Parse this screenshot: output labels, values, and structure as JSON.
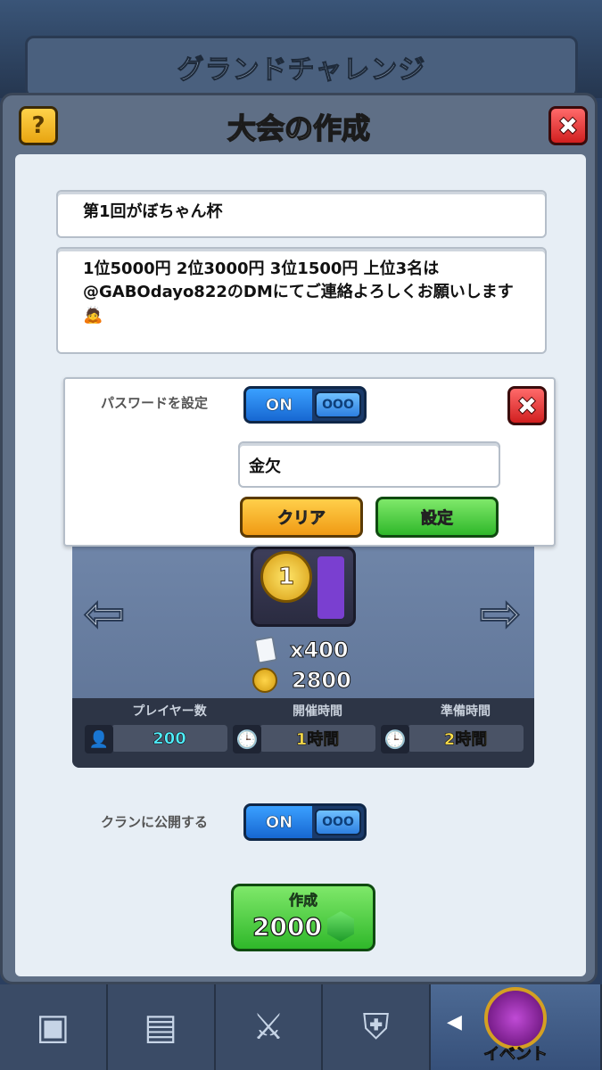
{
  "background_header": "グランドチャレンジ",
  "dialog": {
    "title": "大会の作成",
    "help_label": "?",
    "close_label": "✖"
  },
  "form": {
    "name_value": "第1回がぼちゃん杯",
    "description_value": "1位5000円 2位3000円 3位1500円 上位3名は\n@GABOdayo822のDMにてご連絡よろしくお願いします🙇"
  },
  "password_popup": {
    "label": "パスワードを設定",
    "toggle_on": "ON",
    "toggle_knob": "OOO",
    "close_label": "✖",
    "password_value": "金欠",
    "clear_label": "クリア",
    "set_label": "設定"
  },
  "rewards": {
    "cards": "x400",
    "gold": "2800",
    "medal_number": "1"
  },
  "stats": {
    "players_label": "プレイヤー数",
    "players_value": "200",
    "duration_label": "開催時間",
    "duration_value": "1時間",
    "prep_label": "準備時間",
    "prep_value": "2時間"
  },
  "clan": {
    "label": "クランに公開する",
    "toggle_on": "ON",
    "toggle_knob": "OOO"
  },
  "create": {
    "label": "作成",
    "cost": "2000"
  },
  "nav": {
    "event_label": "イベント"
  },
  "colors": {
    "accent_green": "#2fb82a",
    "accent_blue": "#1767d1",
    "close_red": "#d11f1f"
  }
}
